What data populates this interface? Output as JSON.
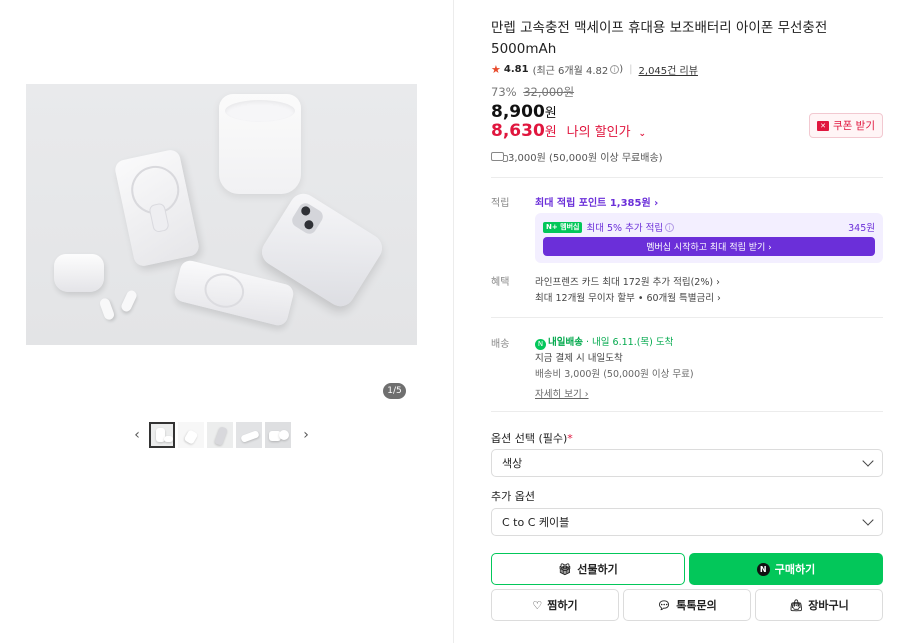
{
  "gallery": {
    "page_indicator": "1/5",
    "prev_arrow": "‹",
    "next_arrow": "›",
    "thumbnail_count": 5,
    "active_thumbnail": 1
  },
  "product": {
    "title": "만렙 고속충전 맥세이프 휴대용 보조배터리 아이폰 무선충전 5000mAh",
    "rating": "4.81",
    "rating_detail_prefix": "(최근 6개월 4.82",
    "rating_detail_suffix": ")",
    "info_icon": "i",
    "review_count": "2,045건 리뷰",
    "discount_rate": "73%",
    "original_price": "32,000원",
    "price_number": "8,900",
    "price_unit": "원",
    "my_price_number": "8,630",
    "my_price_unit": "원",
    "my_price_label": "나의 할인가",
    "coupon_label": "쿠폰 받기",
    "shipping_text": "3,000원 (50,000원 이상 무료배송)"
  },
  "points": {
    "label": "적립",
    "max_point_link": "최대 적립 포인트 1,385원 ›",
    "member_badge": "N+ 멤버십",
    "member_text": "최대 5% 추가 적립",
    "member_amount": "345원",
    "member_button": "멤버십 시작하고 최대 적립 받기 ›"
  },
  "benefits": {
    "label": "혜택",
    "line1": "라인프렌즈 카드 최대 172원 추가 적립(2%) ›",
    "line2": "최대 12개월 무이자 할부 • 60개월 특별금리 ›"
  },
  "delivery": {
    "label": "배송",
    "badge_text": "내일배송",
    "eta": "· 내일 6.11.(목) 도착",
    "line2": "지금 결제 시 내일도착",
    "line3": "배송비 3,000원 (50,000원 이상 무료)",
    "detail_link": "자세히 보기 ›"
  },
  "options": {
    "required_label": "옵션 선택 (필수)",
    "required_mark": "*",
    "required_value": "색상",
    "extra_label": "추가 옵션",
    "extra_value": "C to C 케이블"
  },
  "actions": {
    "gift": "선물하기",
    "buy": "구매하기",
    "buy_icon": "N",
    "wish": "찜하기",
    "talk": "톡톡문의",
    "cart": "장바구니"
  },
  "colors": {
    "naver_green": "#03c75a",
    "sale_red": "#e0163e",
    "membership_purple": "#6b2fd9"
  }
}
